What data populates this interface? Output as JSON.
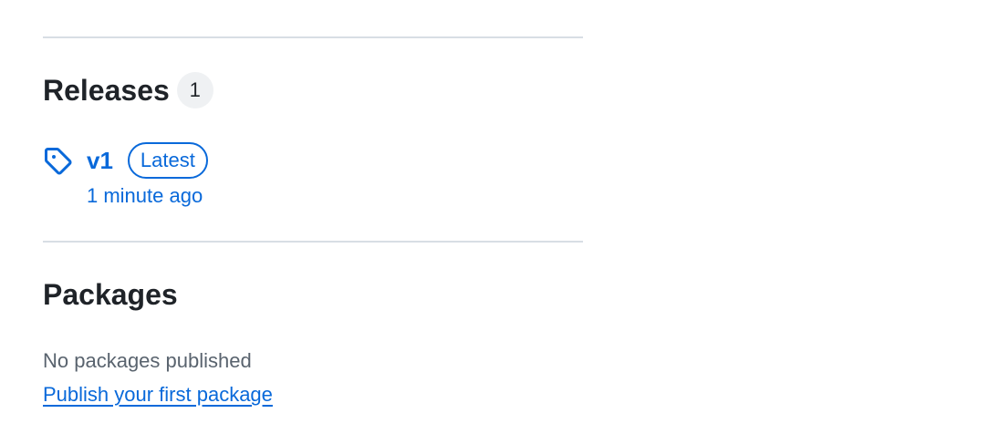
{
  "releases": {
    "heading": "Releases",
    "count": "1",
    "latest_release": {
      "name": "v1",
      "badge": "Latest",
      "time": "1 minute ago"
    }
  },
  "packages": {
    "heading": "Packages",
    "empty_text": "No packages published",
    "publish_link": "Publish your first package"
  },
  "colors": {
    "link": "#0969da",
    "text": "#1f2328",
    "muted": "#59636e",
    "divider": "#d8dee4",
    "counter_bg": "#eff1f3"
  },
  "icons": {
    "release": "tag-icon"
  }
}
